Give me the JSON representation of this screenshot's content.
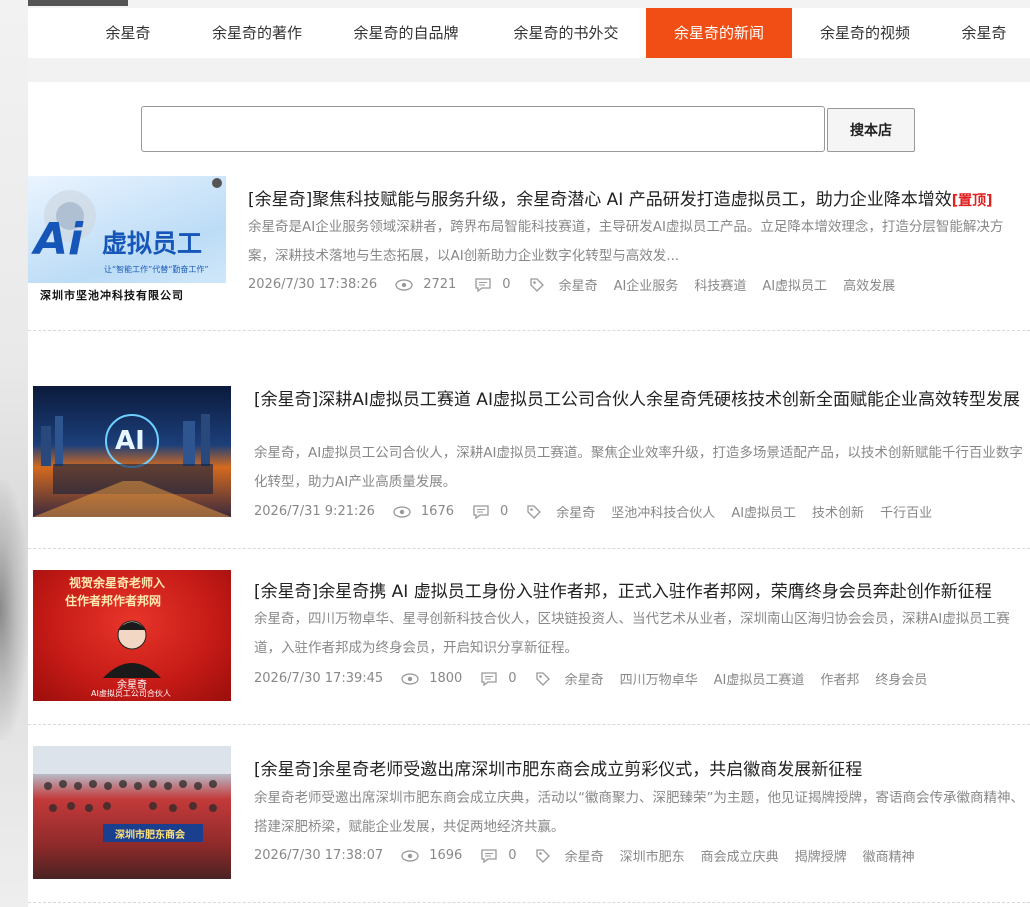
{
  "nav": {
    "items": [
      "余星奇",
      "余星奇的著作",
      "余星奇的自品牌",
      "余星奇的书外交",
      "余星奇的新闻",
      "余星奇的视频",
      "余星奇"
    ],
    "active_index": 4,
    "active_color": "#f04e14"
  },
  "search": {
    "value": "",
    "button_label": "搜本店"
  },
  "articles": [
    {
      "title": "[余星奇]聚焦科技赋能与服务升级，余星奇潜心 AI 产品研发打造虚拟员工，助力企业降本增效",
      "pinned_label": "[置顶]",
      "excerpt": "余星奇是AI企业服务领域深耕者，跨界布局智能科技赛道，主导研发AI虚拟员工产品。立足降本增效理念，打造分层智能解决方案，深耕技术落地与生态拓展，以AI创新助力企业数字化转型与高效发...",
      "date": "2026/7/30 17:38:26",
      "views": "2721",
      "comments": "0",
      "tags": [
        "余星奇",
        "AI企业服务",
        "科技赛道",
        "AI虚拟员工",
        "高效发展"
      ],
      "thumb": {
        "big": "Ai",
        "text": "虚拟员工",
        "slogan": "让“智能工作”代替“勤奋工作”",
        "company": "深圳市坚池冲科技有限公司"
      }
    },
    {
      "title": "[余星奇]深耕AI虚拟员工赛道 AI虚拟员工公司合伙人余星奇凭硬核技术创新全面赋能企业高效转型发展",
      "excerpt": "余星奇，AI虚拟员工公司合伙人，深耕AI虚拟员工赛道。聚焦企业效率升级，打造多场景适配产品，以技术创新赋能千行百业数字化转型，助力AI产业高质量发展。",
      "date": "2026/7/31 9:21:26",
      "views": "1676",
      "comments": "0",
      "tags": [
        "余星奇",
        "坚池冲科技合伙人",
        "AI虚拟员工",
        "技术创新",
        "千行百业"
      ],
      "thumb": {
        "big": "AI"
      }
    },
    {
      "title": "[余星奇]余星奇携 AI 虚拟员工身份入驻作者邦，正式入驻作者邦网，荣膺终身会员奔赴创作新征程",
      "excerpt": "余星奇，四川万物卓华、星寻创新科技合伙人，区块链投资人、当代艺术从业者，深圳南山区海归协会会员，深耕AI虚拟员工赛道，入驻作者邦成为终身会员，开启知识分享新征程。",
      "date": "2026/7/30 17:39:45",
      "views": "1800",
      "comments": "0",
      "tags": [
        "余星奇",
        "四川万物卓华",
        "AI虚拟员工赛道",
        "作者邦",
        "终身会员"
      ],
      "thumb": {
        "line1": "视贺余星奇老师入",
        "line2": "住作者邦作者邦网",
        "name": "余星奇",
        "caption": "AI虚拟员工公司合伙人"
      }
    },
    {
      "title": "[余星奇]余星奇老师受邀出席深圳市肥东商会成立剪彩仪式，共启徽商发展新征程",
      "excerpt": "余星奇老师受邀出席深圳市肥东商会成立庆典，活动以“徽商聚力、深肥臻荣”为主题，他见证揭牌授牌，寄语商会传承徽商精神、搭建深肥桥梁，赋能企业发展，共促两地经济共赢。",
      "date": "2026/7/30 17:38:07",
      "views": "1696",
      "comments": "0",
      "tags": [
        "余星奇",
        "深圳市肥东",
        "商会成立庆典",
        "揭牌授牌",
        "徽商精神"
      ],
      "thumb": {
        "banner": "深圳市肥东商会"
      }
    }
  ]
}
